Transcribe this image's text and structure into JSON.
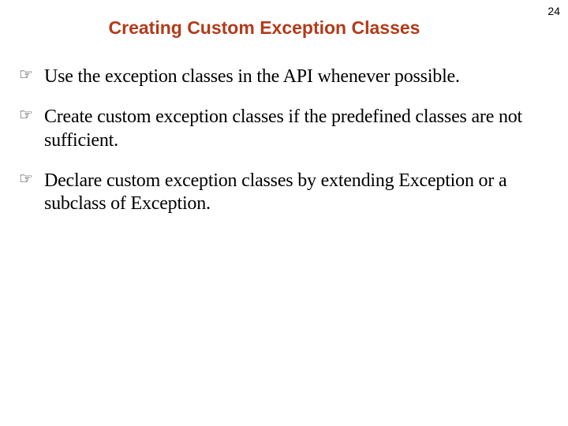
{
  "page_number": "24",
  "title": "Creating Custom Exception Classes",
  "bullets": [
    {
      "text": "Use the exception classes in the API whenever possible."
    },
    {
      "text": "Create custom exception classes if the predefined classes are not sufficient."
    },
    {
      "text": "Declare custom exception classes by extending Exception or a subclass of Exception."
    }
  ],
  "bullet_glyph": "☞"
}
